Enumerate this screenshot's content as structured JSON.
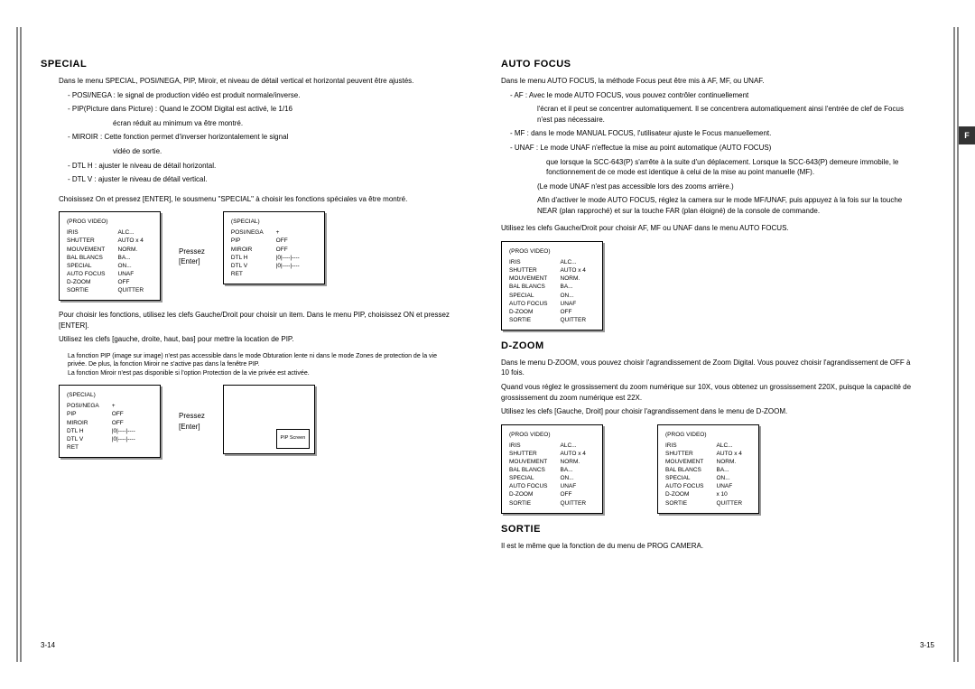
{
  "left": {
    "heading": "SPECIAL",
    "p1": "Dans le menu SPECIAL, POSI/NEGA, PIP, Miroir, et niveau de détail vertical et horizontal peuvent être ajustés.",
    "b1": "- POSI/NEGA : le signal de production vidéo est produit normale/inverse.",
    "b2": "- PIP(Picture dans Picture) : Quand le ZOOM Digital est activé, le 1/16",
    "b2b": "écran réduit au minimum va être montré.",
    "b3": "- MIROIR : Cette fonction permet d'inverser horizontalement le signal",
    "b3b": "vidéo de sortie.",
    "b4": "- DTL H : ajuster le niveau de détail horizontal.",
    "b5": "- DTL V : ajuster le niveau de détail vertical.",
    "p2": "Choisissez On et pressez [ENTER], le sousmenu \"SPECIAL\" à choisir les fonctions spéciales va être montré.",
    "menuA": {
      "title": "(PROG VIDEO)",
      "rows": [
        [
          "IRIS",
          "ALC..."
        ],
        [
          "SHUTTER",
          "AUTO x 4"
        ],
        [
          "MOUVEMENT",
          "NORM."
        ],
        [
          "BAL BLANCS",
          "BA..."
        ],
        [
          "SPECIAL",
          "ON..."
        ],
        [
          "AUTO FOCUS",
          "UNAF"
        ],
        [
          "D-ZOOM",
          "OFF"
        ],
        [
          "SORTIE",
          "QUITTER"
        ]
      ]
    },
    "menuB": {
      "title": "(SPECIAL)",
      "rows": [
        [
          "POSI/NEGA",
          "+"
        ],
        [
          "PIP",
          "OFF"
        ],
        [
          "MIROIR",
          "OFF"
        ],
        [
          "DTL H",
          "|0|----|----"
        ],
        [
          "DTL V",
          "|0|----|----"
        ],
        [
          "RET",
          ""
        ]
      ]
    },
    "arrow1a": "Pressez",
    "arrow1b": "[Enter]",
    "p3": "Pour choisir les fonctions, utilisez les clefs Gauche/Droit pour choisir un item. Dans le menu PIP, choisissez ON et pressez [ENTER].",
    "p4": "Utilisez les clefs [gauche, droite, haut, bas] pour mettre la location de PIP.",
    "note1": "La fonction PIP (image sur image) n'est pas accessible dans le mode Obturation lente ni dans le mode Zones de protection de la vie privée. De plus, la fonction Miroir ne s'active pas dans la fenêtre PIP.",
    "note2": "La fonction Miroir n'est pas disponible si l'option Protection de la vie privée est activée.",
    "menuC": {
      "title": "(SPECIAL)",
      "rows": [
        [
          "POSI/NEGA",
          "+"
        ],
        [
          "PIP",
          "OFF"
        ],
        [
          "MIROIR",
          "OFF"
        ],
        [
          "DTL H",
          "|0|----|----"
        ],
        [
          "DTL V",
          "|0|----|----"
        ],
        [
          "RET",
          ""
        ]
      ]
    },
    "arrow2a": "Pressez",
    "arrow2b": "[Enter]",
    "pip": "PIP Screen",
    "pagenum": "3-14"
  },
  "right": {
    "headingA": "AUTO FOCUS",
    "a1": "Dans le menu AUTO FOCUS, la méthode Focus peut être mis à AF, MF, ou UNAF.",
    "a2": "- AF : Avec le mode AUTO FOCUS, vous pouvez contrôler continuellement",
    "a2b": "l'écran et il peut se concentrer automatiquement. Il se concentrera automatiquement ainsi l'entrée de clef de Focus n'est pas nécessaire.",
    "a3": "- MF : dans le mode MANUAL FOCUS, l'utilisateur ajuste le Focus manuellement.",
    "a4": "- UNAF : Le mode UNAF n'effectue la mise au point automatique (AUTO FOCUS)",
    "a4b": "que lorsque la SCC-643(P) s'arrête à la suite d'un déplacement. Lorsque la SCC-643(P) demeure immobile, le fonctionnement de ce mode est identique à celui de la mise au point manuelle (MF).",
    "a5": "(Le mode UNAF n'est pas accessible lors des zooms arrière.)",
    "a6": "Afin d'activer le mode AUTO FOCUS, réglez la camera sur le mode MF/UNAF, puis appuyez à la fois sur la touche NEAR (plan rapproché) et sur la touche FAR (plan éloigné) de la console de commande.",
    "a7": "Utilisez les clefs Gauche/Droit pour choisir AF, MF ou UNAF dans le menu AUTO FOCUS.",
    "menuD": {
      "title": "(PROG VIDEO)",
      "rows": [
        [
          "IRIS",
          "ALC..."
        ],
        [
          "SHUTTER",
          "AUTO x 4"
        ],
        [
          "MOUVEMENT",
          "NORM."
        ],
        [
          "BAL BLANCS",
          "BA..."
        ],
        [
          "SPECIAL",
          "ON..."
        ],
        [
          "AUTO FOCUS",
          "UNAF"
        ],
        [
          "D-ZOOM",
          "OFF"
        ],
        [
          "SORTIE",
          "QUITTER"
        ]
      ]
    },
    "headingB": "D-ZOOM",
    "dz1": "Dans le menu D-ZOOM, vous pouvez choisir l'agrandissement de Zoom Digital. Vous pouvez choisir l'agrandissement de OFF à 10 fois.",
    "dz2": "Quand vous réglez le grossissement du zoom numérique sur 10X, vous obtenez un grossissement 220X, puisque la capacité de grossissement du zoom numérique est 22X.",
    "dz3": "Utilisez les clefs [Gauche, Droit] pour choisir l'agrandissement dans le menu de D-ZOOM.",
    "menuE": {
      "title": "(PROG VIDEO)",
      "rows": [
        [
          "IRIS",
          "ALC..."
        ],
        [
          "SHUTTER",
          "AUTO x 4"
        ],
        [
          "MOUVEMENT",
          "NORM."
        ],
        [
          "BAL BLANCS",
          "BA..."
        ],
        [
          "SPECIAL",
          "ON..."
        ],
        [
          "AUTO FOCUS",
          "UNAF"
        ],
        [
          "D-ZOOM",
          "OFF"
        ],
        [
          "SORTIE",
          "QUITTER"
        ]
      ]
    },
    "menuF": {
      "title": "(PROG VIDEO)",
      "rows": [
        [
          "IRIS",
          "ALC..."
        ],
        [
          "SHUTTER",
          "AUTO x 4"
        ],
        [
          "MOUVEMENT",
          "NORM."
        ],
        [
          "BAL BLANCS",
          "BA..."
        ],
        [
          "SPECIAL",
          "ON..."
        ],
        [
          "AUTO FOCUS",
          "UNAF"
        ],
        [
          "D-ZOOM",
          "x 10"
        ],
        [
          "SORTIE",
          "QUITTER"
        ]
      ]
    },
    "headingC": "SORTIE",
    "s1": "Il est le même que la fonction de du menu de PROG CAMERA.",
    "pagenum": "3-15",
    "ftab": "F"
  }
}
